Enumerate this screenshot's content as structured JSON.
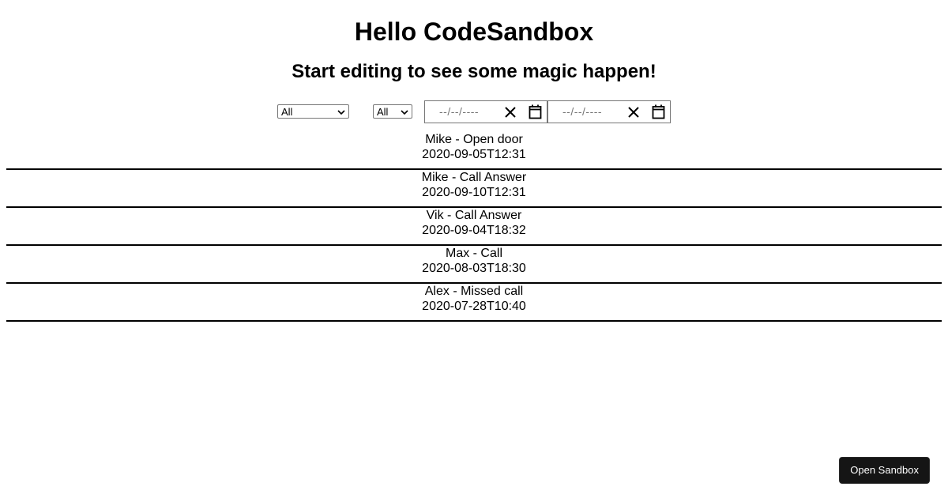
{
  "header": {
    "title": "Hello CodeSandbox",
    "subtitle": "Start editing to see some magic happen!"
  },
  "filters": {
    "type_select": {
      "selected": "All",
      "icon": "chevron-down-icon"
    },
    "user_select": {
      "selected": "All",
      "icon": "chevron-down-icon"
    },
    "date_from": {
      "placeholder": "--/--/----",
      "clear_icon": "close-icon",
      "picker_icon": "calendar-icon"
    },
    "date_to": {
      "placeholder": "--/--/----",
      "clear_icon": "close-icon",
      "picker_icon": "calendar-icon"
    }
  },
  "events": [
    {
      "label": "Mike - Open door",
      "datetime": "2020-09-05T12:31"
    },
    {
      "label": "Mike - Call Answer",
      "datetime": "2020-09-10T12:31"
    },
    {
      "label": "Vik - Call Answer",
      "datetime": "2020-09-04T18:32"
    },
    {
      "label": "Max - Call",
      "datetime": "2020-08-03T18:30"
    },
    {
      "label": "Alex - Missed call",
      "datetime": "2020-07-28T10:40"
    }
  ],
  "footer": {
    "open_sandbox_label": "Open Sandbox"
  }
}
